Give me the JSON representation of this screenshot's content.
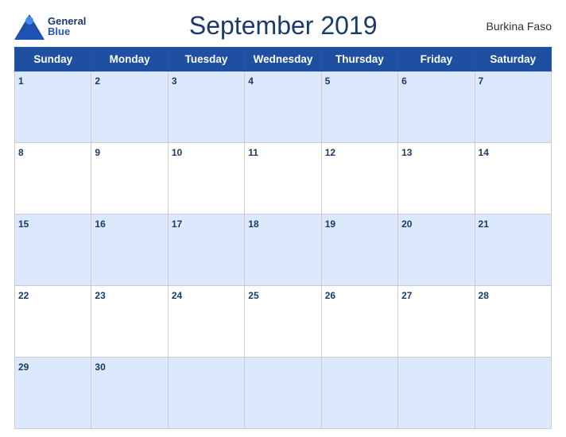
{
  "header": {
    "title": "September 2019",
    "country": "Burkina Faso",
    "logo_general": "General",
    "logo_blue": "Blue"
  },
  "days_of_week": [
    "Sunday",
    "Monday",
    "Tuesday",
    "Wednesday",
    "Thursday",
    "Friday",
    "Saturday"
  ],
  "weeks": [
    [
      {
        "day": "1",
        "empty": false
      },
      {
        "day": "2",
        "empty": false
      },
      {
        "day": "3",
        "empty": false
      },
      {
        "day": "4",
        "empty": false
      },
      {
        "day": "5",
        "empty": false
      },
      {
        "day": "6",
        "empty": false
      },
      {
        "day": "7",
        "empty": false
      }
    ],
    [
      {
        "day": "8",
        "empty": false
      },
      {
        "day": "9",
        "empty": false
      },
      {
        "day": "10",
        "empty": false
      },
      {
        "day": "11",
        "empty": false
      },
      {
        "day": "12",
        "empty": false
      },
      {
        "day": "13",
        "empty": false
      },
      {
        "day": "14",
        "empty": false
      }
    ],
    [
      {
        "day": "15",
        "empty": false
      },
      {
        "day": "16",
        "empty": false
      },
      {
        "day": "17",
        "empty": false
      },
      {
        "day": "18",
        "empty": false
      },
      {
        "day": "19",
        "empty": false
      },
      {
        "day": "20",
        "empty": false
      },
      {
        "day": "21",
        "empty": false
      }
    ],
    [
      {
        "day": "22",
        "empty": false
      },
      {
        "day": "23",
        "empty": false
      },
      {
        "day": "24",
        "empty": false
      },
      {
        "day": "25",
        "empty": false
      },
      {
        "day": "26",
        "empty": false
      },
      {
        "day": "27",
        "empty": false
      },
      {
        "day": "28",
        "empty": false
      }
    ],
    [
      {
        "day": "29",
        "empty": false
      },
      {
        "day": "30",
        "empty": false
      },
      {
        "day": "",
        "empty": true
      },
      {
        "day": "",
        "empty": true
      },
      {
        "day": "",
        "empty": true
      },
      {
        "day": "",
        "empty": true
      },
      {
        "day": "",
        "empty": true
      }
    ]
  ],
  "accent_color": "#1e4fa0",
  "row_odd_bg": "#dce8fb",
  "row_even_bg": "#ffffff"
}
